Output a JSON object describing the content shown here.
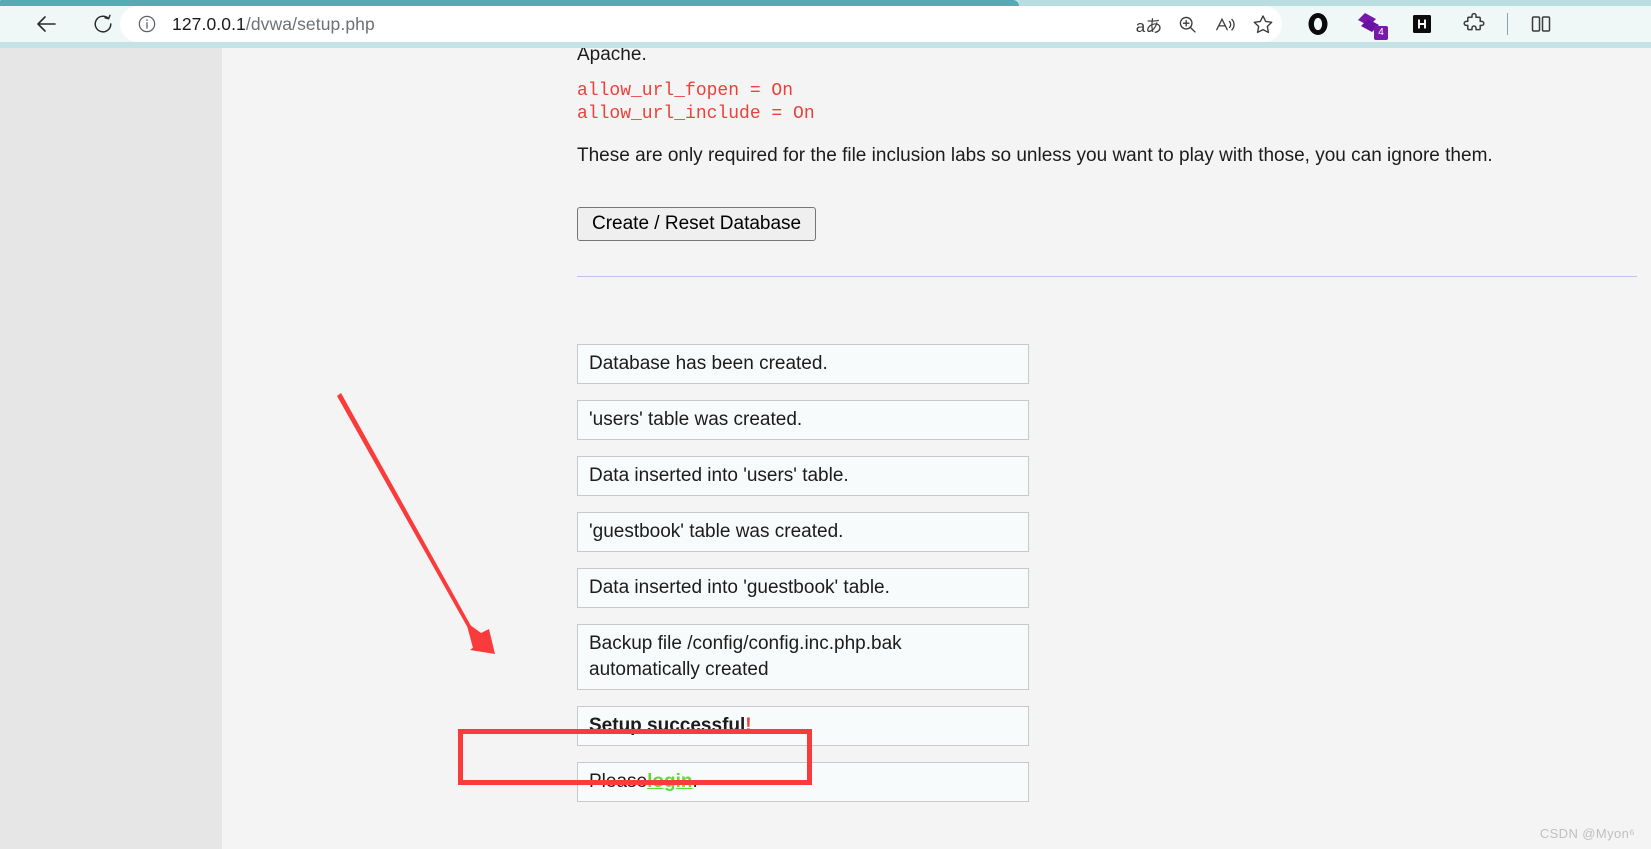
{
  "browser": {
    "back_icon": "back-arrow-icon",
    "reload_icon": "reload-icon",
    "site_info_icon": "info-circle-icon",
    "url_host": "127.0.0.1",
    "url_path": "/dvwa/setup.php",
    "url_full": "127.0.0.1/dvwa/setup.php",
    "address_actions": [
      {
        "name": "read-aloud-icon",
        "glyph": "aあ",
        "label": "aあ"
      },
      {
        "name": "zoom-in-icon",
        "glyph": "⊕",
        "label": "Zoom"
      },
      {
        "name": "read-aloud-voice-icon",
        "glyph": "A",
        "label": "A"
      },
      {
        "name": "favorite-star-icon",
        "glyph": "☆",
        "label": "Add to favorites"
      }
    ],
    "extensions": [
      {
        "name": "opera-ring-icon",
        "badge": ""
      },
      {
        "name": "purple-diamond-extension-icon",
        "badge": "4"
      },
      {
        "name": "h-square-extension-icon",
        "badge": ""
      },
      {
        "name": "puzzle-extensions-icon",
        "badge": ""
      },
      {
        "name": "split-screen-icon",
        "badge": ""
      }
    ]
  },
  "page": {
    "apache_line": "Apache.",
    "code_lines": [
      "allow_url_fopen = On",
      "allow_url_include = On"
    ],
    "intro_paragraph": "These are only required for the file inclusion labs so unless you want to play with those, you can ignore them.",
    "create_reset_button": "Create / Reset Database",
    "status_messages": [
      {
        "text": "Database has been created.",
        "style": "normal"
      },
      {
        "text": "'users' table was created.",
        "style": "normal"
      },
      {
        "text": "Data inserted into 'users' table.",
        "style": "normal"
      },
      {
        "text": "'guestbook' table was created.",
        "style": "normal"
      },
      {
        "text": "Data inserted into 'guestbook' table.",
        "style": "normal"
      },
      {
        "text": "Backup file /config/config.inc.php.bak automatically created",
        "style": "two-line"
      },
      {
        "text": "Setup successful!",
        "style": "success",
        "bold_text": "Setup successful",
        "exclamation": "!"
      },
      {
        "text": "Please login.",
        "style": "link",
        "prefix": "Please ",
        "link_text": "login",
        "suffix": "."
      }
    ]
  },
  "annotations": {
    "arrow_color": "#f93b3b",
    "highlight_color": "#f93b3b",
    "arrow_target": "Setup successful!"
  },
  "watermark": "CSDN @Myon⁶",
  "colors": {
    "chrome_bg": "#c4e3e6",
    "toolbar_bg": "#eff7f7",
    "tab_accent": "#55aab4",
    "page_bg": "#f4f4f4",
    "gutter_bg": "#e6e6e6",
    "code_red": "#e8423a",
    "link_green": "#5ddb33",
    "annotation_red": "#f93b3b",
    "divider_blue": "#b9c6e6"
  }
}
